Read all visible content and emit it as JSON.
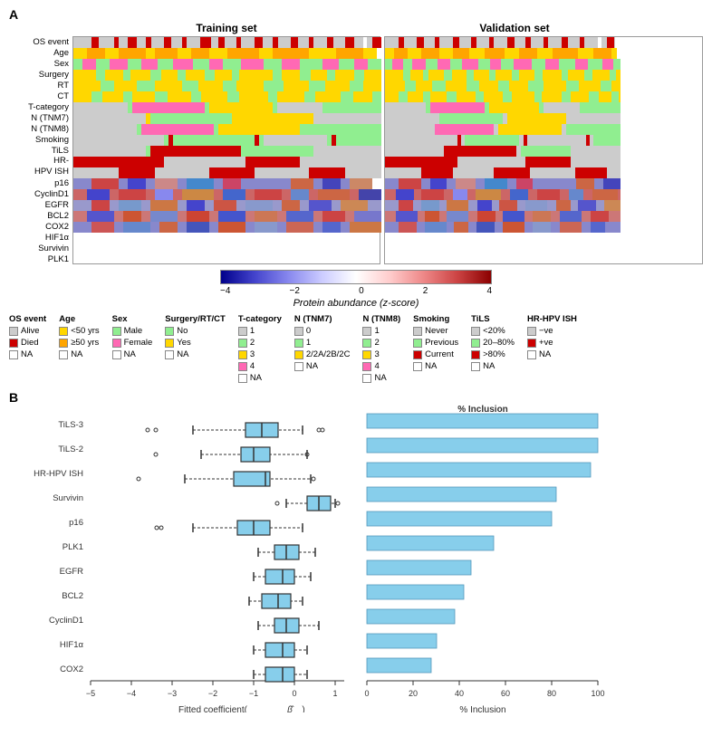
{
  "figure": {
    "panel_a_label": "A",
    "panel_b_label": "B",
    "heatmap": {
      "training_title": "Training set",
      "validation_title": "Validation set",
      "row_labels": [
        "OS event",
        "Age",
        "Sex",
        "Surgery",
        "RT",
        "CT",
        "T-category",
        "N (TNM7)",
        "N (TNM8)",
        "Smoking",
        "TiLS",
        "HR-\nHPV ISH",
        "p16",
        "CyclinD1",
        "EGFR",
        "BCL2",
        "COX2",
        "HIF1α",
        "Survivin",
        "PLK1"
      ],
      "color_scale": {
        "title": "Protein abundance (z-score)",
        "labels": [
          "-4",
          "-2",
          "0",
          "2",
          "4"
        ]
      }
    },
    "legend": {
      "groups": [
        {
          "title": "OS event",
          "items": [
            {
              "label": "Alive",
              "color": "#CCCCCC"
            },
            {
              "label": "Died",
              "color": "#CC0000"
            },
            {
              "label": "NA",
              "color": "#FFFFFF"
            }
          ]
        },
        {
          "title": "Age",
          "items": [
            {
              "label": "<50 yrs",
              "color": "#FFD700"
            },
            {
              "label": "≥50 yrs",
              "color": "#FFA500"
            },
            {
              "label": "NA",
              "color": "#FFFFFF"
            }
          ]
        },
        {
          "title": "Sex",
          "items": [
            {
              "label": "Male",
              "color": "#90EE90"
            },
            {
              "label": "Female",
              "color": "#FF69B4"
            },
            {
              "label": "NA",
              "color": "#FFFFFF"
            }
          ]
        },
        {
          "title": "Surgery/RT/CT",
          "items": [
            {
              "label": "No",
              "color": "#90EE90"
            },
            {
              "label": "Yes",
              "color": "#FFD700"
            },
            {
              "label": "NA",
              "color": "#FFFFFF"
            }
          ]
        },
        {
          "title": "T-category",
          "items": [
            {
              "label": "1",
              "color": "#CCCCCC"
            },
            {
              "label": "2",
              "color": "#90EE90"
            },
            {
              "label": "3",
              "color": "#FFD700"
            },
            {
              "label": "4",
              "color": "#FF69B4"
            },
            {
              "label": "NA",
              "color": "#FFFFFF"
            }
          ]
        },
        {
          "title": "N (TNM7)",
          "items": [
            {
              "label": "0",
              "color": "#CCCCCC"
            },
            {
              "label": "1",
              "color": "#90EE90"
            },
            {
              "label": "2/2A/2B/2C",
              "color": "#FFD700"
            },
            {
              "label": "NA",
              "color": "#FFFFFF"
            }
          ]
        },
        {
          "title": "N (TNM8)",
          "items": [
            {
              "label": "1",
              "color": "#CCCCCC"
            },
            {
              "label": "2",
              "color": "#90EE90"
            },
            {
              "label": "3",
              "color": "#FFD700"
            },
            {
              "label": "4",
              "color": "#FF69B4"
            },
            {
              "label": "NA",
              "color": "#FFFFFF"
            }
          ]
        },
        {
          "title": "Smoking",
          "items": [
            {
              "label": "Never",
              "color": "#CCCCCC"
            },
            {
              "label": "Previous",
              "color": "#90EE90"
            },
            {
              "label": "Current",
              "color": "#CC0000"
            },
            {
              "label": "NA",
              "color": "#FFFFFF"
            }
          ]
        },
        {
          "title": "TiLS",
          "items": [
            {
              "label": "<20%",
              "color": "#CCCCCC"
            },
            {
              "label": "20–80%",
              "color": "#90EE90"
            },
            {
              "label": ">80%",
              "color": "#CC0000"
            },
            {
              "label": "NA",
              "color": "#FFFFFF"
            }
          ]
        },
        {
          "title": "HR-HPV ISH",
          "items": [
            {
              "label": "-ve",
              "color": "#CCCCCC"
            },
            {
              "label": "+ve",
              "color": "#CC0000"
            },
            {
              "label": "NA",
              "color": "#FFFFFF"
            }
          ]
        }
      ]
    },
    "boxplot": {
      "rows": [
        {
          "label": "TiLS-3",
          "median": -0.8,
          "q1": -1.2,
          "q3": -0.4,
          "whisker_low": -2.5,
          "whisker_high": 0.2,
          "outliers": [
            -3.2,
            -3.0,
            0.6,
            0.7
          ]
        },
        {
          "label": "TiLS-2",
          "median": -0.9,
          "q1": -1.3,
          "q3": -0.5,
          "whisker_low": -2.2,
          "whisker_high": 0.3,
          "outliers": [
            -3.0,
            0.5
          ]
        },
        {
          "label": "HR-HPV ISH",
          "median": -0.7,
          "q1": -1.5,
          "q3": -0.3,
          "whisker_low": -2.8,
          "whisker_high": 0.4,
          "outliers": [
            -3.5,
            0.6
          ]
        },
        {
          "label": "Survivin",
          "median": 0.6,
          "q1": 0.3,
          "q3": 0.9,
          "whisker_low": -0.2,
          "whisker_high": 1.2,
          "outliers": [
            -0.5,
            1.4
          ]
        },
        {
          "label": "p16",
          "median": -0.9,
          "q1": -1.4,
          "q3": -0.4,
          "whisker_low": -2.5,
          "whisker_high": 0.2,
          "outliers": [
            -2.8,
            -2.7
          ]
        },
        {
          "label": "PLK1",
          "median": -0.2,
          "q1": -0.5,
          "q3": 0.1,
          "whisker_low": -0.9,
          "whisker_high": 0.5,
          "outliers": []
        },
        {
          "label": "EGFR",
          "median": -0.3,
          "q1": -0.6,
          "q3": 0.0,
          "whisker_low": -1.0,
          "whisker_high": 0.4,
          "outliers": []
        },
        {
          "label": "BCL2",
          "median": -0.4,
          "q1": -0.7,
          "q3": -0.1,
          "whisker_low": -1.1,
          "whisker_high": 0.2,
          "outliers": []
        },
        {
          "label": "CyclinD1",
          "median": -0.2,
          "q1": -0.5,
          "q3": 0.1,
          "whisker_low": -0.9,
          "whisker_high": 0.6,
          "outliers": []
        },
        {
          "label": "HIF1α",
          "median": -0.3,
          "q1": -0.6,
          "q3": 0.0,
          "whisker_low": -1.0,
          "whisker_high": 0.3,
          "outliers": []
        },
        {
          "label": "COX2",
          "median": -0.3,
          "q1": -0.6,
          "q3": 0.0,
          "whisker_low": -1.0,
          "whisker_high": 0.3,
          "outliers": []
        }
      ],
      "x_axis": {
        "label": "Fitted coefficient(β̂)",
        "ticks": [
          "-5",
          "-4",
          "-3",
          "-2",
          "-1",
          "0",
          "1"
        ]
      }
    },
    "inclusion": {
      "rows": [
        {
          "label": "TiLS-3",
          "percent": 100
        },
        {
          "label": "TiLS-2",
          "percent": 100
        },
        {
          "label": "HR-HPV ISH",
          "percent": 97
        },
        {
          "label": "Survivin",
          "percent": 82
        },
        {
          "label": "p16",
          "percent": 80
        },
        {
          "label": "PLK1",
          "percent": 55
        },
        {
          "label": "EGFR",
          "percent": 45
        },
        {
          "label": "BCL2",
          "percent": 42
        },
        {
          "label": "CyclinD1",
          "percent": 38
        },
        {
          "label": "HIF1α",
          "percent": 30
        },
        {
          "label": "COX2",
          "percent": 28
        }
      ],
      "x_axis": {
        "label": "% Inclusion",
        "ticks": [
          "0",
          "20",
          "40",
          "60",
          "80",
          "100"
        ]
      }
    }
  }
}
